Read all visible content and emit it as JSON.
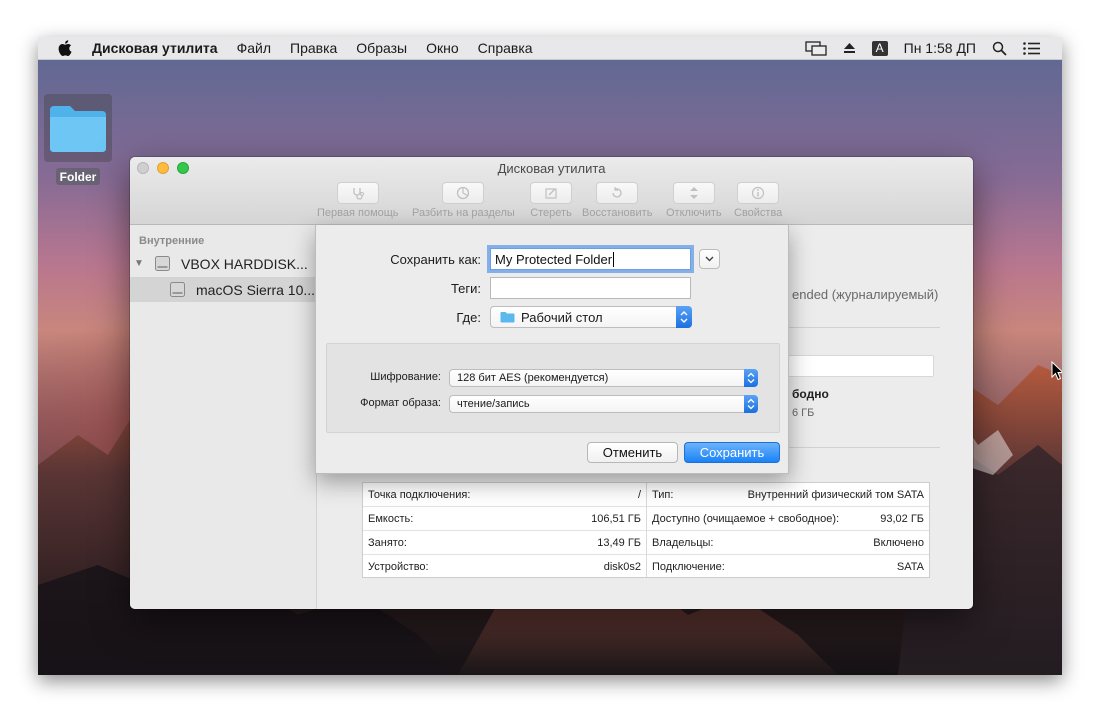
{
  "menubar": {
    "app_name": "Дисковая утилита",
    "items": [
      "Файл",
      "Правка",
      "Образы",
      "Окно",
      "Справка"
    ],
    "input_source": "A",
    "clock": "Пн 1:58 ДП"
  },
  "desktop": {
    "folder_label": "Folder"
  },
  "window": {
    "title": "Дисковая утилита",
    "toolbar": [
      {
        "label": "Первая помощь",
        "icon": "stethoscope-icon"
      },
      {
        "label": "Разбить на разделы",
        "icon": "pie-chart-icon"
      },
      {
        "label": "Стереть",
        "icon": "eraser-icon"
      },
      {
        "label": "Восстановить",
        "icon": "restore-icon"
      },
      {
        "label": "Отключить",
        "icon": "eject-icon"
      },
      {
        "label": "Свойства",
        "icon": "info-icon"
      }
    ],
    "sidebar": {
      "section": "Внутренние",
      "disk": "VBOX HARDDISK...",
      "volume": "macOS Sierra 10..."
    },
    "main": {
      "format_partial": "ended (журналируемый)",
      "free_partial": "бодно",
      "size_partial": "6 ГБ"
    },
    "info_left": [
      {
        "k": "Точка подключения:",
        "v": "/"
      },
      {
        "k": "Емкость:",
        "v": "106,51 ГБ"
      },
      {
        "k": "Занято:",
        "v": "13,49 ГБ"
      },
      {
        "k": "Устройство:",
        "v": "disk0s2"
      }
    ],
    "info_right": [
      {
        "k": "Тип:",
        "v": "Внутренний физический том SATA"
      },
      {
        "k": "Доступно (очищаемое + свободное):",
        "v": "93,02 ГБ"
      },
      {
        "k": "Владельцы:",
        "v": "Включено"
      },
      {
        "k": "Подключение:",
        "v": "SATA"
      }
    ]
  },
  "save_sheet": {
    "save_as_label": "Сохранить как:",
    "save_as_value": "My Protected Folder",
    "tags_label": "Теги:",
    "tags_value": "",
    "where_label": "Где:",
    "where_value": "Рабочий стол",
    "encryption_label": "Шифрование:",
    "encryption_value": "128 бит AES (рекомендуется)",
    "format_label": "Формат образа:",
    "format_value": "чтение/запись",
    "cancel_label": "Отменить",
    "save_label": "Сохранить"
  },
  "colors": {
    "accent": "#1a82f7",
    "traffic_close": "#cfcfcf",
    "traffic_min": "#fdbc40",
    "traffic_max": "#34c84a"
  }
}
